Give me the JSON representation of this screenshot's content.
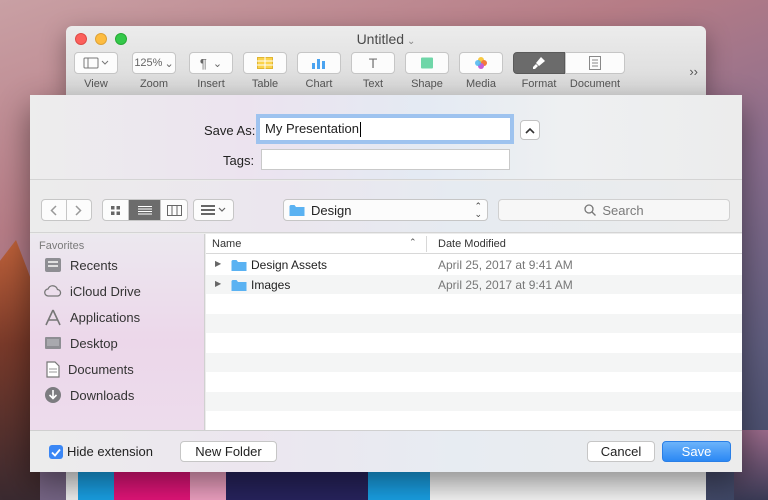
{
  "window": {
    "title": "Untitled"
  },
  "toolbar": {
    "view": {
      "label": "View"
    },
    "zoom": {
      "label": "Zoom",
      "value": "125%"
    },
    "insert": {
      "label": "Insert",
      "glyph": "¶"
    },
    "table": {
      "label": "Table"
    },
    "chart": {
      "label": "Chart"
    },
    "text": {
      "label": "Text",
      "glyph": "T"
    },
    "shape": {
      "label": "Shape"
    },
    "media": {
      "label": "Media"
    },
    "format": {
      "label": "Format"
    },
    "document": {
      "label": "Document"
    },
    "more": "››"
  },
  "save_sheet": {
    "save_as_label": "Save As:",
    "save_as_value": "My Presentation",
    "tags_label": "Tags:",
    "tags_value": ""
  },
  "navigation": {
    "location": "Design",
    "search_placeholder": "Search"
  },
  "sidebar": {
    "heading": "Favorites",
    "items": [
      {
        "label": "Recents",
        "icon": "recents-icon"
      },
      {
        "label": "iCloud Drive",
        "icon": "cloud-icon"
      },
      {
        "label": "Applications",
        "icon": "applications-icon"
      },
      {
        "label": "Desktop",
        "icon": "desktop-icon"
      },
      {
        "label": "Documents",
        "icon": "documents-icon"
      },
      {
        "label": "Downloads",
        "icon": "downloads-icon"
      }
    ]
  },
  "file_list": {
    "columns": {
      "name": "Name",
      "date": "Date Modified"
    },
    "rows": [
      {
        "name": "Design Assets",
        "date": "April 25, 2017 at 9:41 AM"
      },
      {
        "name": "Images",
        "date": "April 25, 2017 at 9:41 AM"
      }
    ]
  },
  "footer": {
    "hide_extension_label": "Hide extension",
    "hide_extension_checked": true,
    "new_folder_label": "New Folder",
    "cancel_label": "Cancel",
    "save_label": "Save"
  },
  "colors": {
    "accent": "#3b87f5",
    "folder": "#5ab2f2"
  }
}
